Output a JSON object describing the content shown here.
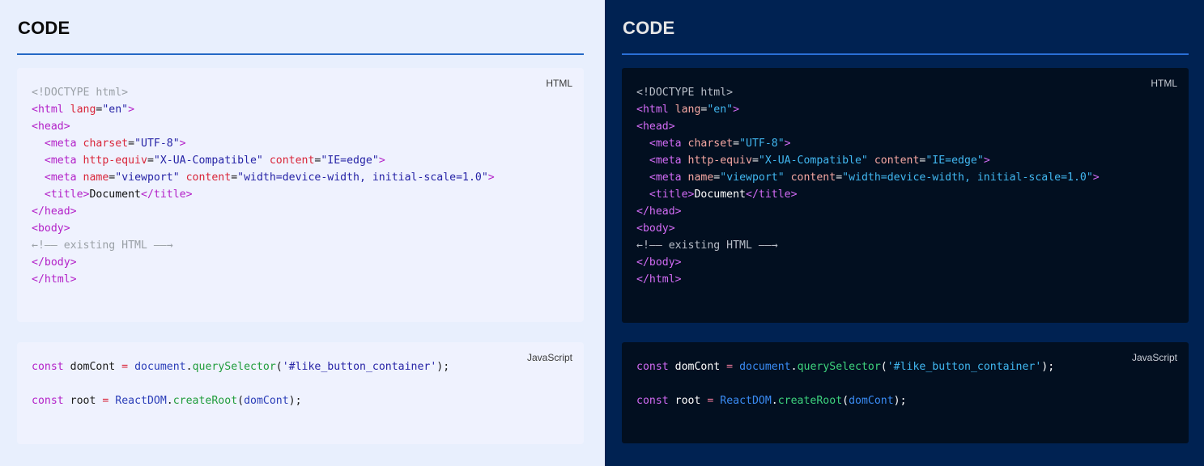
{
  "section_title": "CODE",
  "html_block": {
    "lang_label": "HTML",
    "lines": [
      [
        {
          "t": "<!DOCTYPE html>",
          "k": "cm"
        }
      ],
      [
        {
          "t": "<html",
          "k": "tag"
        },
        {
          "t": " lang",
          "k": "at"
        },
        {
          "t": "=",
          "k": "eq"
        },
        {
          "t": "\"en\"",
          "k": "str"
        },
        {
          "t": ">",
          "k": "tag"
        }
      ],
      [
        {
          "t": "<head>",
          "k": "tag"
        }
      ],
      [
        {
          "t": "  ",
          "k": "tx"
        },
        {
          "t": "<meta",
          "k": "tag"
        },
        {
          "t": " charset",
          "k": "at"
        },
        {
          "t": "=",
          "k": "eq"
        },
        {
          "t": "\"UTF-8\"",
          "k": "str"
        },
        {
          "t": ">",
          "k": "tag"
        }
      ],
      [
        {
          "t": "  ",
          "k": "tx"
        },
        {
          "t": "<meta",
          "k": "tag"
        },
        {
          "t": " http-equiv",
          "k": "at"
        },
        {
          "t": "=",
          "k": "eq"
        },
        {
          "t": "\"X-UA-Compatible\"",
          "k": "str"
        },
        {
          "t": " content",
          "k": "at"
        },
        {
          "t": "=",
          "k": "eq"
        },
        {
          "t": "\"IE=edge\"",
          "k": "str"
        },
        {
          "t": ">",
          "k": "tag"
        }
      ],
      [
        {
          "t": "  ",
          "k": "tx"
        },
        {
          "t": "<meta",
          "k": "tag"
        },
        {
          "t": " name",
          "k": "at"
        },
        {
          "t": "=",
          "k": "eq"
        },
        {
          "t": "\"viewport\"",
          "k": "str"
        },
        {
          "t": " content",
          "k": "at"
        },
        {
          "t": "=",
          "k": "eq"
        },
        {
          "t": "\"width=device-width, initial-scale=1.0\"",
          "k": "str"
        },
        {
          "t": ">",
          "k": "tag"
        }
      ],
      [
        {
          "t": "  ",
          "k": "tx"
        },
        {
          "t": "<title>",
          "k": "tag"
        },
        {
          "t": "Document",
          "k": "tx"
        },
        {
          "t": "</title>",
          "k": "tag"
        }
      ],
      [
        {
          "t": "</head>",
          "k": "tag"
        }
      ],
      [
        {
          "t": "<body>",
          "k": "tag"
        }
      ],
      [
        {
          "t": "←!—— existing HTML ——→",
          "k": "cm"
        }
      ],
      [
        {
          "t": "</body>",
          "k": "tag"
        }
      ],
      [
        {
          "t": "</html>",
          "k": "tag"
        }
      ]
    ]
  },
  "js_block": {
    "lang_label": "JavaScript",
    "lines": [
      [
        {
          "t": "const",
          "k": "kw"
        },
        {
          "t": " domCont ",
          "k": "id"
        },
        {
          "t": "=",
          "k": "op"
        },
        {
          "t": " ",
          "k": "id"
        },
        {
          "t": "document",
          "k": "obj"
        },
        {
          "t": ".",
          "k": "pu"
        },
        {
          "t": "querySelector",
          "k": "fn"
        },
        {
          "t": "(",
          "k": "pu"
        },
        {
          "t": "'#like_button_container'",
          "k": "str"
        },
        {
          "t": ");",
          "k": "pu"
        }
      ],
      [],
      [
        {
          "t": "const",
          "k": "kw"
        },
        {
          "t": " root ",
          "k": "id"
        },
        {
          "t": "=",
          "k": "op"
        },
        {
          "t": " ",
          "k": "id"
        },
        {
          "t": "ReactDOM",
          "k": "obj"
        },
        {
          "t": ".",
          "k": "pu"
        },
        {
          "t": "createRoot",
          "k": "fn"
        },
        {
          "t": "(",
          "k": "pu"
        },
        {
          "t": "domCont",
          "k": "obj"
        },
        {
          "t": ");",
          "k": "pu"
        }
      ]
    ]
  }
}
